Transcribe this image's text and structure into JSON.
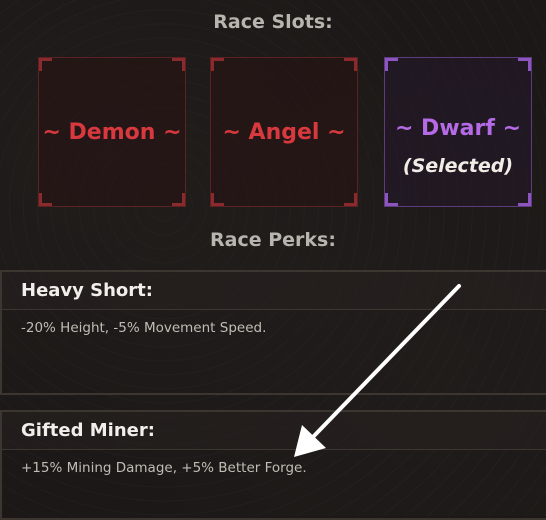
{
  "race_slots": {
    "heading": "Race Slots:",
    "slots": [
      {
        "name": "~ Demon ~",
        "status": ""
      },
      {
        "name": "~ Angel ~",
        "status": ""
      },
      {
        "name": "~ Dwarf ~",
        "status": "(Selected)"
      }
    ]
  },
  "race_perks": {
    "heading": "Race Perks:",
    "perks": [
      {
        "title": "Heavy Short:",
        "description": "-20% Height, -5% Movement Speed."
      },
      {
        "title": "Gifted Miner:",
        "description": "+15% Mining Damage, +5% Better Forge."
      }
    ]
  },
  "colors": {
    "demon": "#d8393f",
    "angel": "#d8393f",
    "dwarf_selected": "#b56ae6",
    "background": "#1b1817"
  },
  "annotation": {
    "icon": "arrow-icon",
    "color": "#ffffff"
  }
}
